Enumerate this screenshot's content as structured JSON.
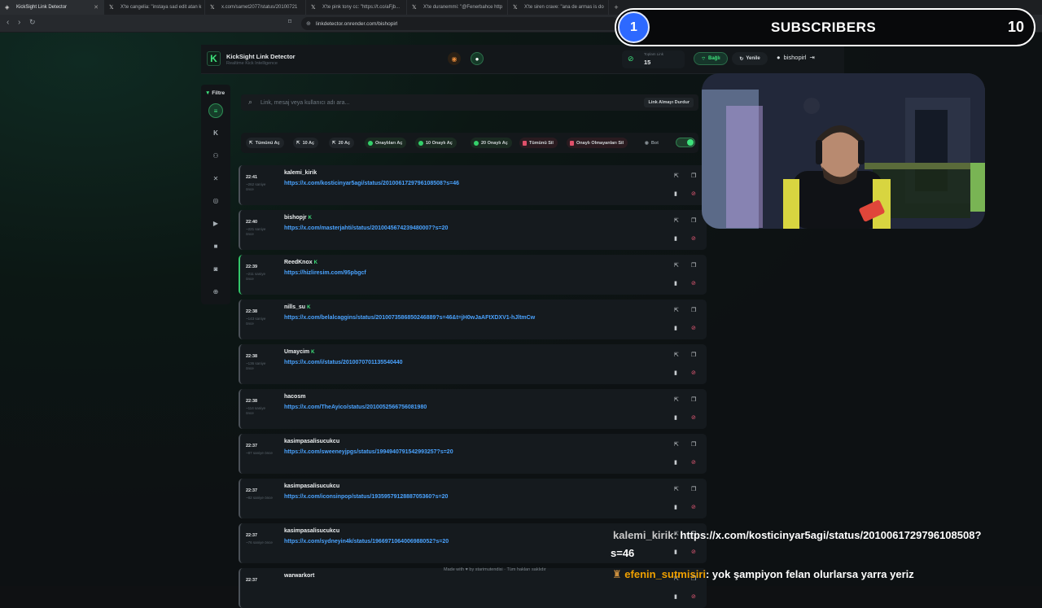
{
  "browser": {
    "tabs": [
      {
        "title": "KickSight Link Detector",
        "active": true
      },
      {
        "title": "X'te cangelia: \"instaya sad edit atan k",
        "active": false
      },
      {
        "title": "x.com/samet2077/status/20100721",
        "active": false
      },
      {
        "title": "X'te pink tony cc: \"https://t.co/aFjb...",
        "active": false
      },
      {
        "title": "X'te duranemmi: \"@Fenerbahce http",
        "active": false
      },
      {
        "title": "X'te siren crave: \"ana de armas is do",
        "active": false
      }
    ],
    "url": "linkdetector.onrender.com/bishopirl"
  },
  "app": {
    "title": "KickSight Link Detector",
    "subtitle": "Realtime Kick Intelligence",
    "total_label": "Toplam Link",
    "total_value": "15",
    "connected_label": "Bağlı",
    "refresh_label": "Yenile",
    "username": "bishopirl"
  },
  "sidebar": {
    "filter_label": "Filtre"
  },
  "search": {
    "placeholder": "Link, mesaj veya kullanıcı adı ara...",
    "stop_label": "Link Almayı Durdur"
  },
  "toolbar": {
    "open_all": "Tümünü Aç",
    "open_10": "10 Aç",
    "open_20": "20 Aç",
    "open_approved": "Onaylıları Aç",
    "open_10_approved": "10 Onaylı Aç",
    "open_20_approved": "20 Onaylı Aç",
    "delete_all": "Tümünü Sil",
    "delete_unapproved": "Onaylı Olmayanları Sil",
    "bot_label": "Bot"
  },
  "rows": [
    {
      "time": "22:41",
      "ago": "~262 saniye önce",
      "user": "kalemi_kirik",
      "verified": false,
      "link": "https://x.com/kosticinyar5agi/status/2010061729796108508?s=46",
      "highlight": false
    },
    {
      "time": "22:40",
      "ago": "~221 saniye önce",
      "user": "bishopjr",
      "verified": true,
      "link": "https://x.com/masterjahti/status/2010045674239480007?s=20",
      "highlight": false
    },
    {
      "time": "22:39",
      "ago": "~211 saniye önce",
      "user": "ReedKnox",
      "verified": true,
      "link": "https://hizliresim.com/95pbgcf",
      "highlight": true
    },
    {
      "time": "22:38",
      "ago": "~143 saniye önce",
      "user": "nills_su",
      "verified": true,
      "link": "https://x.com/belalcaggins/status/2010073586850246889?s=46&t=jH0wJaAFtXDXV1-hJltmCw",
      "highlight": false
    },
    {
      "time": "22:38",
      "ago": "~136 saniye önce",
      "user": "Umaycim",
      "verified": true,
      "link": "https://x.com/i/status/2010070701135540440",
      "highlight": false
    },
    {
      "time": "22:38",
      "ago": "~114 saniye önce",
      "user": "hacosm",
      "verified": false,
      "link": "https://x.com/TheAyico/status/2010052566756081980",
      "highlight": false
    },
    {
      "time": "22:37",
      "ago": "~87 saniye önce",
      "user": "kasimpasalisucukcu",
      "verified": false,
      "link": "https://x.com/sweeneyjpgs/status/1994940791542993257?s=20",
      "highlight": false
    },
    {
      "time": "22:37",
      "ago": "~82 saniye önce",
      "user": "kasimpasalisucukcu",
      "verified": false,
      "link": "https://x.com/iconsinpop/status/1935957912888705360?s=20",
      "highlight": false
    },
    {
      "time": "22:37",
      "ago": "~76 saniye önce",
      "user": "kasimpasalisucukcu",
      "verified": false,
      "link": "https://x.com/sydneyin4k/status/1966971064006988052?s=20",
      "highlight": false
    },
    {
      "time": "22:37",
      "ago": "",
      "user": "warwarkort",
      "verified": false,
      "link": "",
      "highlight": false
    }
  ],
  "footer": {
    "text": "Made with ♥ by starimutendisi · Tüm hakları saklıdır"
  },
  "overlay": {
    "subs_number": "1",
    "subs_label": "SUBSCRIBERS",
    "subs_count": "10",
    "chat": [
      {
        "user": "kalemi_kirik:",
        "line1": "https://x.com/kosticinyar5agi/status/2010061729796108508?",
        "line2": "s=46"
      },
      {
        "user": "efenin_sutmisiri",
        "line1": ": yok şampiyon felan olurlarsa yarra yeriz"
      }
    ]
  },
  "colors": {
    "accent": "#3ee27c",
    "link": "#4aa3ff",
    "danger": "#ee5c79",
    "subs_blue": "#2d69ff"
  }
}
